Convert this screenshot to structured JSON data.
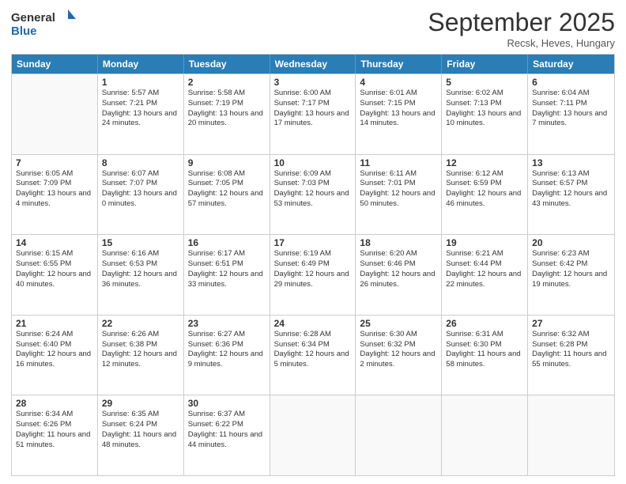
{
  "header": {
    "logo_general": "General",
    "logo_blue": "Blue",
    "month_title": "September 2025",
    "subtitle": "Recsk, Heves, Hungary"
  },
  "days_of_week": [
    "Sunday",
    "Monday",
    "Tuesday",
    "Wednesday",
    "Thursday",
    "Friday",
    "Saturday"
  ],
  "weeks": [
    [
      {
        "day": "",
        "sunrise": "",
        "sunset": "",
        "daylight": ""
      },
      {
        "day": "1",
        "sunrise": "Sunrise: 5:57 AM",
        "sunset": "Sunset: 7:21 PM",
        "daylight": "Daylight: 13 hours and 24 minutes."
      },
      {
        "day": "2",
        "sunrise": "Sunrise: 5:58 AM",
        "sunset": "Sunset: 7:19 PM",
        "daylight": "Daylight: 13 hours and 20 minutes."
      },
      {
        "day": "3",
        "sunrise": "Sunrise: 6:00 AM",
        "sunset": "Sunset: 7:17 PM",
        "daylight": "Daylight: 13 hours and 17 minutes."
      },
      {
        "day": "4",
        "sunrise": "Sunrise: 6:01 AM",
        "sunset": "Sunset: 7:15 PM",
        "daylight": "Daylight: 13 hours and 14 minutes."
      },
      {
        "day": "5",
        "sunrise": "Sunrise: 6:02 AM",
        "sunset": "Sunset: 7:13 PM",
        "daylight": "Daylight: 13 hours and 10 minutes."
      },
      {
        "day": "6",
        "sunrise": "Sunrise: 6:04 AM",
        "sunset": "Sunset: 7:11 PM",
        "daylight": "Daylight: 13 hours and 7 minutes."
      }
    ],
    [
      {
        "day": "7",
        "sunrise": "Sunrise: 6:05 AM",
        "sunset": "Sunset: 7:09 PM",
        "daylight": "Daylight: 13 hours and 4 minutes."
      },
      {
        "day": "8",
        "sunrise": "Sunrise: 6:07 AM",
        "sunset": "Sunset: 7:07 PM",
        "daylight": "Daylight: 13 hours and 0 minutes."
      },
      {
        "day": "9",
        "sunrise": "Sunrise: 6:08 AM",
        "sunset": "Sunset: 7:05 PM",
        "daylight": "Daylight: 12 hours and 57 minutes."
      },
      {
        "day": "10",
        "sunrise": "Sunrise: 6:09 AM",
        "sunset": "Sunset: 7:03 PM",
        "daylight": "Daylight: 12 hours and 53 minutes."
      },
      {
        "day": "11",
        "sunrise": "Sunrise: 6:11 AM",
        "sunset": "Sunset: 7:01 PM",
        "daylight": "Daylight: 12 hours and 50 minutes."
      },
      {
        "day": "12",
        "sunrise": "Sunrise: 6:12 AM",
        "sunset": "Sunset: 6:59 PM",
        "daylight": "Daylight: 12 hours and 46 minutes."
      },
      {
        "day": "13",
        "sunrise": "Sunrise: 6:13 AM",
        "sunset": "Sunset: 6:57 PM",
        "daylight": "Daylight: 12 hours and 43 minutes."
      }
    ],
    [
      {
        "day": "14",
        "sunrise": "Sunrise: 6:15 AM",
        "sunset": "Sunset: 6:55 PM",
        "daylight": "Daylight: 12 hours and 40 minutes."
      },
      {
        "day": "15",
        "sunrise": "Sunrise: 6:16 AM",
        "sunset": "Sunset: 6:53 PM",
        "daylight": "Daylight: 12 hours and 36 minutes."
      },
      {
        "day": "16",
        "sunrise": "Sunrise: 6:17 AM",
        "sunset": "Sunset: 6:51 PM",
        "daylight": "Daylight: 12 hours and 33 minutes."
      },
      {
        "day": "17",
        "sunrise": "Sunrise: 6:19 AM",
        "sunset": "Sunset: 6:49 PM",
        "daylight": "Daylight: 12 hours and 29 minutes."
      },
      {
        "day": "18",
        "sunrise": "Sunrise: 6:20 AM",
        "sunset": "Sunset: 6:46 PM",
        "daylight": "Daylight: 12 hours and 26 minutes."
      },
      {
        "day": "19",
        "sunrise": "Sunrise: 6:21 AM",
        "sunset": "Sunset: 6:44 PM",
        "daylight": "Daylight: 12 hours and 22 minutes."
      },
      {
        "day": "20",
        "sunrise": "Sunrise: 6:23 AM",
        "sunset": "Sunset: 6:42 PM",
        "daylight": "Daylight: 12 hours and 19 minutes."
      }
    ],
    [
      {
        "day": "21",
        "sunrise": "Sunrise: 6:24 AM",
        "sunset": "Sunset: 6:40 PM",
        "daylight": "Daylight: 12 hours and 16 minutes."
      },
      {
        "day": "22",
        "sunrise": "Sunrise: 6:26 AM",
        "sunset": "Sunset: 6:38 PM",
        "daylight": "Daylight: 12 hours and 12 minutes."
      },
      {
        "day": "23",
        "sunrise": "Sunrise: 6:27 AM",
        "sunset": "Sunset: 6:36 PM",
        "daylight": "Daylight: 12 hours and 9 minutes."
      },
      {
        "day": "24",
        "sunrise": "Sunrise: 6:28 AM",
        "sunset": "Sunset: 6:34 PM",
        "daylight": "Daylight: 12 hours and 5 minutes."
      },
      {
        "day": "25",
        "sunrise": "Sunrise: 6:30 AM",
        "sunset": "Sunset: 6:32 PM",
        "daylight": "Daylight: 12 hours and 2 minutes."
      },
      {
        "day": "26",
        "sunrise": "Sunrise: 6:31 AM",
        "sunset": "Sunset: 6:30 PM",
        "daylight": "Daylight: 11 hours and 58 minutes."
      },
      {
        "day": "27",
        "sunrise": "Sunrise: 6:32 AM",
        "sunset": "Sunset: 6:28 PM",
        "daylight": "Daylight: 11 hours and 55 minutes."
      }
    ],
    [
      {
        "day": "28",
        "sunrise": "Sunrise: 6:34 AM",
        "sunset": "Sunset: 6:26 PM",
        "daylight": "Daylight: 11 hours and 51 minutes."
      },
      {
        "day": "29",
        "sunrise": "Sunrise: 6:35 AM",
        "sunset": "Sunset: 6:24 PM",
        "daylight": "Daylight: 11 hours and 48 minutes."
      },
      {
        "day": "30",
        "sunrise": "Sunrise: 6:37 AM",
        "sunset": "Sunset: 6:22 PM",
        "daylight": "Daylight: 11 hours and 44 minutes."
      },
      {
        "day": "",
        "sunrise": "",
        "sunset": "",
        "daylight": ""
      },
      {
        "day": "",
        "sunrise": "",
        "sunset": "",
        "daylight": ""
      },
      {
        "day": "",
        "sunrise": "",
        "sunset": "",
        "daylight": ""
      },
      {
        "day": "",
        "sunrise": "",
        "sunset": "",
        "daylight": ""
      }
    ]
  ]
}
